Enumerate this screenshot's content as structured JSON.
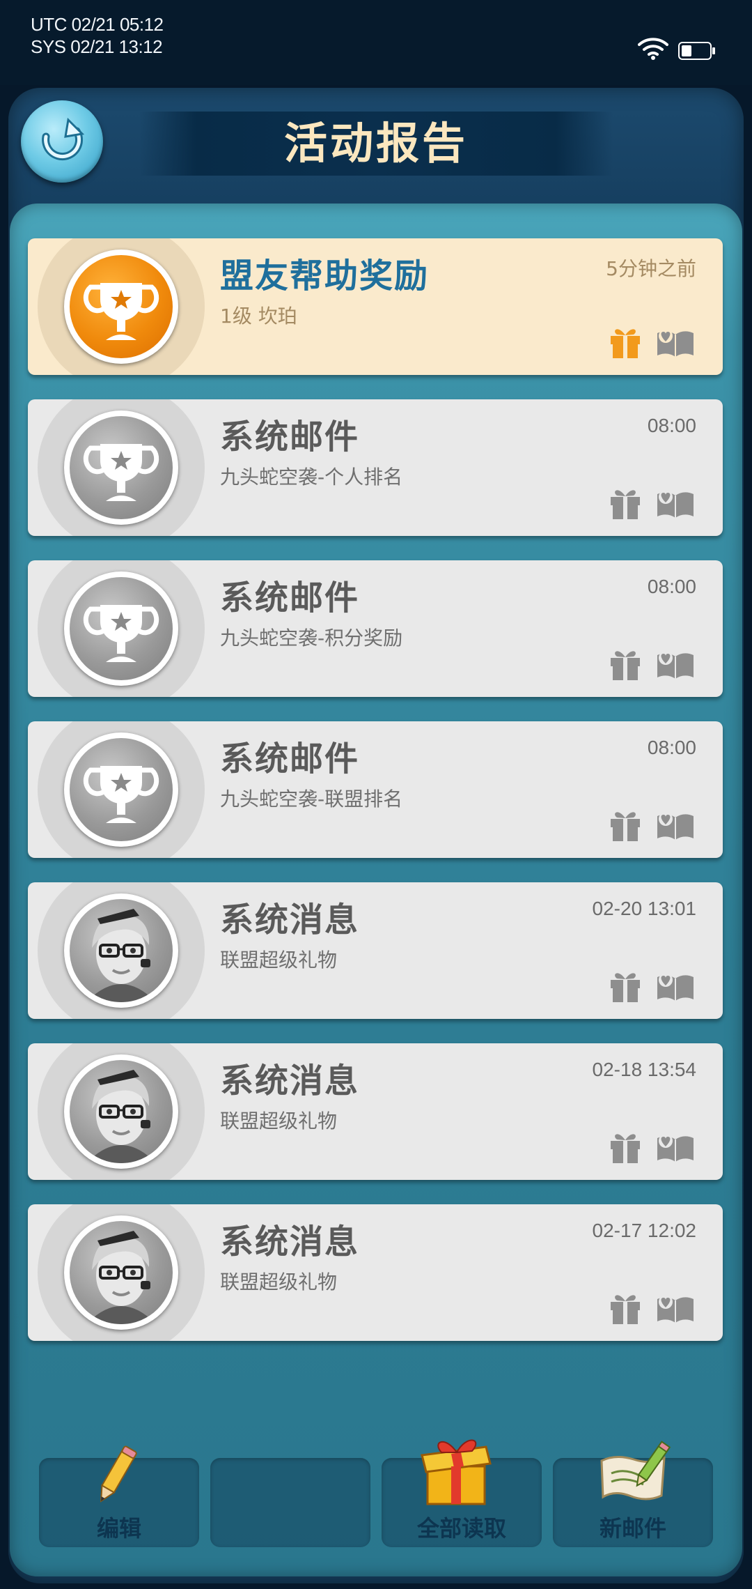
{
  "status_bar": {
    "utc_time": "UTC 02/21 05:12",
    "sys_time": "SYS 02/21 13:12"
  },
  "header": {
    "title": "活动报告"
  },
  "mail_items": [
    {
      "title": "盟友帮助奖励",
      "subtitle": "1级 坎珀",
      "time": "5分钟之前",
      "avatar_icon": "trophy-icon",
      "highlight": true
    },
    {
      "title": "系统邮件",
      "subtitle": "九头蛇空袭-个人排名",
      "time": "08:00",
      "avatar_icon": "trophy-icon",
      "highlight": false
    },
    {
      "title": "系统邮件",
      "subtitle": "九头蛇空袭-积分奖励",
      "time": "08:00",
      "avatar_icon": "trophy-icon",
      "highlight": false
    },
    {
      "title": "系统邮件",
      "subtitle": "九头蛇空袭-联盟排名",
      "time": "08:00",
      "avatar_icon": "trophy-icon",
      "highlight": false
    },
    {
      "title": "系统消息",
      "subtitle": "联盟超级礼物",
      "time": "02-20 13:01",
      "avatar_icon": "advisor-portrait-icon",
      "highlight": false
    },
    {
      "title": "系统消息",
      "subtitle": "联盟超级礼物",
      "time": "02-18 13:54",
      "avatar_icon": "advisor-portrait-icon",
      "highlight": false
    },
    {
      "title": "系统消息",
      "subtitle": "联盟超级礼物",
      "time": "02-17 12:02",
      "avatar_icon": "advisor-portrait-icon",
      "highlight": false
    }
  ],
  "bottom_bar": {
    "edit_label": "编辑",
    "read_all_label": "全部读取",
    "new_mail_label": "新邮件"
  },
  "colors": {
    "highlight_card": "#faeacc",
    "card": "#e9e9e9",
    "title_text": "#fbe7bf",
    "highlight_title": "#1f6f9c",
    "gift_active": "#f29a1c",
    "icon_inactive": "#8e8e8e"
  }
}
